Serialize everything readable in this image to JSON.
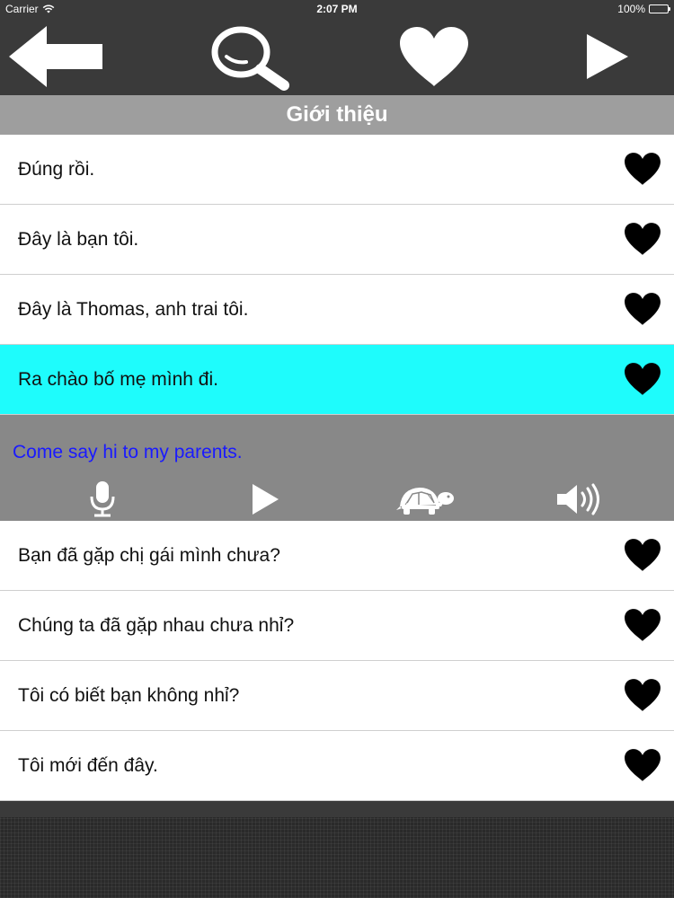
{
  "status_bar": {
    "carrier": "Carrier",
    "time": "2:07 PM",
    "battery": "100%"
  },
  "toolbar": {
    "back_icon": "back-arrow-icon",
    "search_icon": "magnifier-icon",
    "favorites_icon": "heart-icon",
    "play_icon": "play-icon"
  },
  "section": {
    "title": "Giới thiệu"
  },
  "phrases": [
    {
      "text": "Đúng rồi."
    },
    {
      "text": "Đây là bạn tôi."
    },
    {
      "text": "Đây là Thomas, anh trai tôi."
    },
    {
      "text": "Ra chào bố mẹ mình đi.",
      "selected": true
    }
  ],
  "detail": {
    "translation": "Come say hi to my parents.",
    "controls": [
      "microphone-icon",
      "play-icon",
      "turtle-icon",
      "speaker-icon"
    ]
  },
  "phrases_after": [
    {
      "text": "Bạn đã gặp chị gái mình chưa?"
    },
    {
      "text": "Chúng ta đã gặp nhau chưa nhỉ?"
    },
    {
      "text": "Tôi có biết bạn không nhỉ?"
    },
    {
      "text": "Tôi mới đến đây."
    }
  ],
  "colors": {
    "toolbar_bg": "#3a3a3a",
    "section_header_bg": "#9e9e9e",
    "selected_row_bg": "#1efcfc",
    "detail_bg": "#888888",
    "translation_text": "#1a1aff"
  }
}
